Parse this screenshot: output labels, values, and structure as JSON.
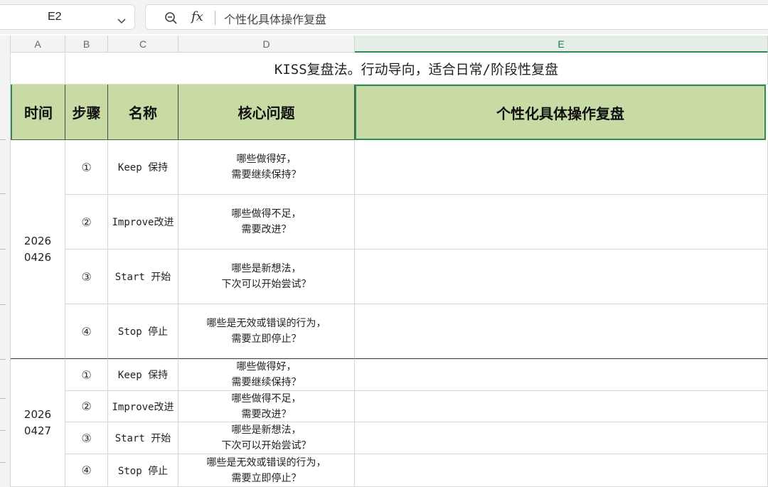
{
  "toolbar": {
    "cell_ref": "E2",
    "fx_label": "fx",
    "formula_content": "个性化具体操作复盘"
  },
  "columns": [
    "A",
    "B",
    "C",
    "D",
    "E"
  ],
  "sheet": {
    "title": "KISS复盘法。行动导向，适合日常/阶段性复盘",
    "headers": {
      "time": "时间",
      "step": "步骤",
      "name": "名称",
      "question": "核心问题",
      "detail": "个性化具体操作复盘"
    },
    "groups": [
      {
        "date_line1": "2026",
        "date_line2": "0426",
        "rows": [
          {
            "step": "①",
            "name": "Keep 保持",
            "q1": "哪些做得好，",
            "q2": "需要继续保持？"
          },
          {
            "step": "②",
            "name": "Improve改进",
            "q1": "哪些做得不足，",
            "q2": "需要改进？"
          },
          {
            "step": "③",
            "name": "Start 开始",
            "q1": "哪些是新想法，",
            "q2": "下次可以开始尝试？"
          },
          {
            "step": "④",
            "name": "Stop 停止",
            "q1": "哪些是无效或错误的行为，",
            "q2": "需要立即停止？"
          }
        ]
      },
      {
        "date_line1": "2026",
        "date_line2": "0427",
        "rows": [
          {
            "step": "①",
            "name": "Keep 保持",
            "q1": "哪些做得好，",
            "q2": "需要继续保持？"
          },
          {
            "step": "②",
            "name": "Improve改进",
            "q1": "哪些做得不足，",
            "q2": "需要改进？"
          },
          {
            "step": "③",
            "name": "Start 开始",
            "q1": "哪些是新想法，",
            "q2": "下次可以开始尝试？"
          },
          {
            "step": "④",
            "name": "Stop 停止",
            "q1": "哪些是无效或错误的行为，",
            "q2": "需要立即停止？"
          }
        ]
      }
    ]
  },
  "colors": {
    "header_fill": "#c8dba5",
    "selection": "#2e8b57"
  }
}
